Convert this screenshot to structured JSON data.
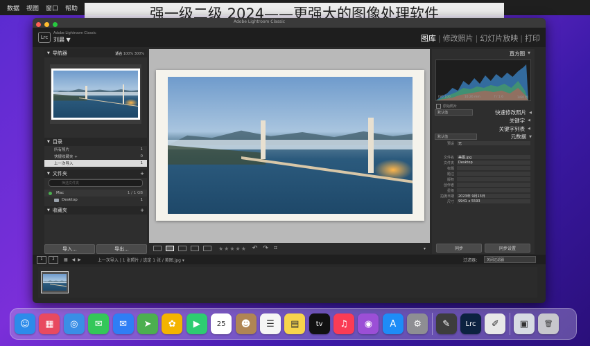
{
  "menubar": {
    "items": [
      "数据",
      "视图",
      "窗口",
      "帮助"
    ]
  },
  "banner": {
    "title": "强一级二级 2024——更强大的图像处理软件"
  },
  "window": {
    "title": "Adobe Lightroom Classic",
    "traffic_lights": [
      "close",
      "minimize",
      "zoom"
    ]
  },
  "topbar": {
    "logo": "Lrc",
    "brand": "Adobe Lightroom Classic",
    "user": "刘晨 ▼",
    "modules": [
      {
        "label": "图库",
        "active": true
      },
      {
        "label": "修改照片",
        "active": false
      },
      {
        "label": "幻灯片放映",
        "active": false
      },
      {
        "label": "打印",
        "active": false
      }
    ]
  },
  "left_panel": {
    "navigator": {
      "title": "导航器",
      "options": [
        "适合",
        "100%",
        "300%"
      ]
    },
    "catalog": {
      "title": "目录",
      "items": [
        {
          "label": "所有照片",
          "count": "1"
        },
        {
          "label": "快捷收藏夹 +",
          "count": "0"
        },
        {
          "label": "上一次导入",
          "count": "1",
          "selected": true
        }
      ]
    },
    "folders": {
      "title": "文件夹",
      "search_placeholder": "筛选文件夹",
      "drive": {
        "label": "Mac",
        "size": "1 / 1 GB"
      },
      "folder": {
        "label": "Desktop",
        "count": "1"
      }
    },
    "collections": {
      "title": "收藏夹"
    },
    "import_button": "导入...",
    "export_button": "导出..."
  },
  "toolbar": {
    "stars": "★★★★★",
    "count": "1/1"
  },
  "right_panel": {
    "histogram": {
      "title": "直方图",
      "iso": "ISO 100",
      "focal": "10.26 mm",
      "aperture": "f / 1.6",
      "shutter": "1/60 秒",
      "original_photo": "原始照片"
    },
    "quick_develop": {
      "preset": "默认值",
      "label": "快速修改照片"
    },
    "keywording": {
      "label": "关键字"
    },
    "keyword_list": {
      "label": "关键字列表"
    },
    "metadata": {
      "label": "元数据",
      "preset_label": "预设",
      "preset_value": "无",
      "view": "默认值",
      "rows": [
        {
          "label": "文件名",
          "value": "美图.jpg"
        },
        {
          "label": "文件夹",
          "value": "Desktop"
        },
        {
          "label": "标题",
          "value": ""
        },
        {
          "label": "题注",
          "value": ""
        },
        {
          "label": "版权",
          "value": ""
        },
        {
          "label": "创作者",
          "value": ""
        },
        {
          "label": "星级",
          "value": ""
        },
        {
          "label": "拍摄日期",
          "value": "2023年 9月13日"
        },
        {
          "label": "尺寸",
          "value": "9941 x 5593"
        }
      ]
    },
    "sync_button": "同步",
    "sync_settings_button": "同步设置"
  },
  "filmstrip_bar": {
    "page1": "1",
    "page2": "2",
    "breadcrumb": "上一次导入 | 1 张照片 / 选定 1 张 / 美图.jpg ▾",
    "filter_label": "过滤器：",
    "filter_value": "关闭过滤器"
  },
  "dock": {
    "apps": [
      {
        "name": "finder-icon",
        "glyph": "☺",
        "color": "#2d8bea"
      },
      {
        "name": "launchpad-icon",
        "glyph": "▦",
        "color": "#e84a5f"
      },
      {
        "name": "safari-icon",
        "glyph": "◎",
        "color": "#3a8ee6"
      },
      {
        "name": "messages-icon",
        "glyph": "✉",
        "color": "#34c759"
      },
      {
        "name": "mail-icon",
        "glyph": "✉",
        "color": "#2f7ef5"
      },
      {
        "name": "maps-icon",
        "glyph": "➤",
        "color": "#4caf50"
      },
      {
        "name": "photos-icon",
        "glyph": "✿",
        "color": "#f4b400"
      },
      {
        "name": "facetime-icon",
        "glyph": "▶",
        "color": "#2ecc71"
      },
      {
        "name": "calendar-icon",
        "glyph": "25",
        "color": "#ffffff"
      },
      {
        "name": "contacts-icon",
        "glyph": "☻",
        "color": "#b08554"
      },
      {
        "name": "reminders-icon",
        "glyph": "☰",
        "color": "#f5f5f5"
      },
      {
        "name": "notes-icon",
        "glyph": "▤",
        "color": "#f7d44c"
      },
      {
        "name": "tv-icon",
        "glyph": "tv",
        "color": "#111111"
      },
      {
        "name": "music-icon",
        "glyph": "♫",
        "color": "#fa3c55"
      },
      {
        "name": "podcasts-icon",
        "glyph": "◉",
        "color": "#9b4fd6"
      },
      {
        "name": "appstore-icon",
        "glyph": "A",
        "color": "#1e8cf7"
      },
      {
        "name": "settings-icon",
        "glyph": "⚙",
        "color": "#8e8e93"
      },
      {
        "name": "preview-icon",
        "glyph": "✎",
        "color": "#3d3d3d"
      },
      {
        "name": "lightroom-icon",
        "glyph": "Lrc",
        "color": "#0c2240"
      },
      {
        "name": "textedit-icon",
        "glyph": "✐",
        "color": "#e8e8e8"
      },
      {
        "name": "downloads-icon",
        "glyph": "▣",
        "color": "#d7dbe3"
      },
      {
        "name": "trash-icon",
        "glyph": "🗑",
        "color": "#c7c7cc"
      }
    ]
  }
}
